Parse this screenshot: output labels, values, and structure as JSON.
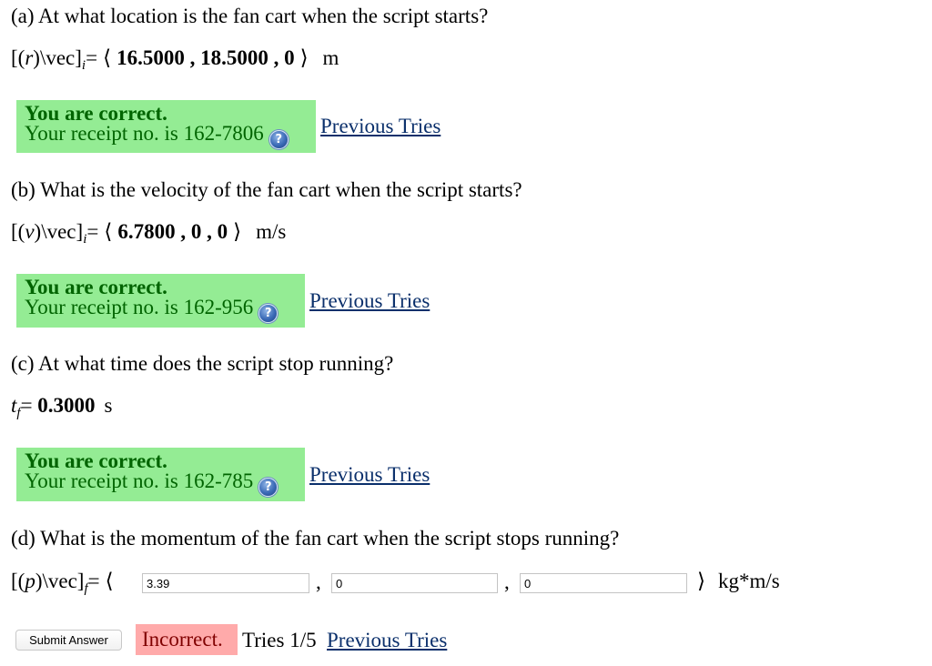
{
  "parts": [
    {
      "question": "(a) At what location is the fan cart when the script starts?",
      "formula": {
        "prefix": "[(",
        "var": "r",
        "suffix": ")\\vec]",
        "subscript": "i",
        "equals": "=",
        "open_bracket": "⟨",
        "close_bracket": "⟩",
        "value": "16.5000 , 18.5000 , 0",
        "unit": "m"
      },
      "feedback": {
        "title": "You are correct.",
        "receipt": "Your receipt no. is 162-7806",
        "help_icon": "question-mark-icon"
      },
      "previous_tries_label": "Previous Tries"
    },
    {
      "question": "(b) What is the velocity of the fan cart when the script starts?",
      "formula": {
        "prefix": "[(",
        "var": "v",
        "suffix": ")\\vec]",
        "subscript": "i",
        "equals": "=",
        "open_bracket": "⟨",
        "close_bracket": "⟩",
        "value": "6.7800 , 0 , 0",
        "unit": "m/s"
      },
      "feedback": {
        "title": "You are correct.",
        "receipt": "Your receipt no. is 162-956",
        "help_icon": "question-mark-icon"
      },
      "previous_tries_label": "Previous Tries"
    },
    {
      "question": "(c) At what time does the script stop running?",
      "formula": {
        "var": "t",
        "subscript": "f",
        "equals": "=",
        "value": "0.3000",
        "unit": "s"
      },
      "feedback": {
        "title": "You are correct.",
        "receipt": "Your receipt no. is 162-785",
        "help_icon": "question-mark-icon"
      },
      "previous_tries_label": "Previous Tries"
    },
    {
      "question": "(d) What is the momentum of the fan cart when the script stops running?",
      "formula": {
        "prefix": "[(",
        "var": "p",
        "suffix": ")\\vec]",
        "subscript": "f",
        "equals": "=",
        "open_bracket": "⟨",
        "close_bracket": "⟩",
        "separator": ",",
        "inputs": [
          "3.39",
          "0",
          "0"
        ],
        "unit": "kg*m/s"
      },
      "submit_label": "Submit Answer",
      "status": "Incorrect.",
      "tries": "Tries 1/5",
      "previous_tries_label": "Previous Tries"
    }
  ],
  "colors": {
    "correct_bg": "#94ec94",
    "correct_text": "#006400",
    "incorrect_bg": "#ffaaaa",
    "incorrect_text": "#800000",
    "link": "#0a2f6b"
  }
}
